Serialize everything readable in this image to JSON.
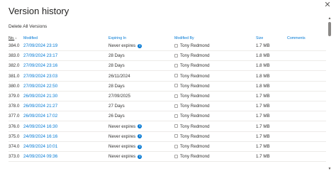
{
  "panel": {
    "title": "Version history",
    "close_icon": "✕",
    "delete_all_label": "Delete All Versions"
  },
  "columns": {
    "no": "No.",
    "modified": "Modified",
    "expiring_in": "Expiring In",
    "modified_by": "Modified By",
    "size": "Size",
    "comments": "Comments"
  },
  "rows": [
    {
      "no": "384.0",
      "modified": "27/09/2024 23:19",
      "expiring": "Never expires",
      "info": true,
      "by": "Tony Redmond",
      "size": "1.7 MB"
    },
    {
      "no": "383.0",
      "modified": "27/09/2024 23:17",
      "expiring": "28 Days",
      "info": false,
      "by": "Tony Redmond",
      "size": "1.8 MB"
    },
    {
      "no": "382.0",
      "modified": "27/09/2024 23:16",
      "expiring": "28 Days",
      "info": false,
      "by": "Tony Redmond",
      "size": "1.8 MB"
    },
    {
      "no": "381.0",
      "modified": "27/09/2024 23:03",
      "expiring": "26/11/2024",
      "info": false,
      "by": "Tony Redmond",
      "size": "1.8 MB"
    },
    {
      "no": "380.0",
      "modified": "27/09/2024 22:50",
      "expiring": "28 Days",
      "info": false,
      "by": "Tony Redmond",
      "size": "1.8 MB"
    },
    {
      "no": "379.0",
      "modified": "26/09/2024 21:30",
      "expiring": "27/09/2025",
      "info": false,
      "by": "Tony Redmond",
      "size": "1.7 MB"
    },
    {
      "no": "378.0",
      "modified": "26/09/2024 21:27",
      "expiring": "27 Days",
      "info": false,
      "by": "Tony Redmond",
      "size": "1.7 MB"
    },
    {
      "no": "377.0",
      "modified": "26/09/2024 17:02",
      "expiring": "26 Days",
      "info": false,
      "by": "Tony Redmond",
      "size": "1.7 MB"
    },
    {
      "no": "376.0",
      "modified": "24/09/2024 16:30",
      "expiring": "Never expires",
      "info": true,
      "by": "Tony Redmond",
      "size": "1.7 MB"
    },
    {
      "no": "375.0",
      "modified": "24/09/2024 16:16",
      "expiring": "Never expires",
      "info": true,
      "by": "Tony Redmond",
      "size": "1.7 MB"
    },
    {
      "no": "374.0",
      "modified": "24/09/2024 10:01",
      "expiring": "Never expires",
      "info": true,
      "by": "Tony Redmond",
      "size": "1.7 MB"
    },
    {
      "no": "373.0",
      "modified": "24/09/2024 09:36",
      "expiring": "Never expires",
      "info": true,
      "by": "Tony Redmond",
      "size": "1.7 MB"
    }
  ],
  "icons": {
    "info": "information-circle-icon",
    "sort": "sort-descending-icon",
    "checkbox": "checkbox-icon"
  },
  "colors": {
    "link": "#0078d4",
    "text": "#323130",
    "divider": "#edebe9"
  }
}
